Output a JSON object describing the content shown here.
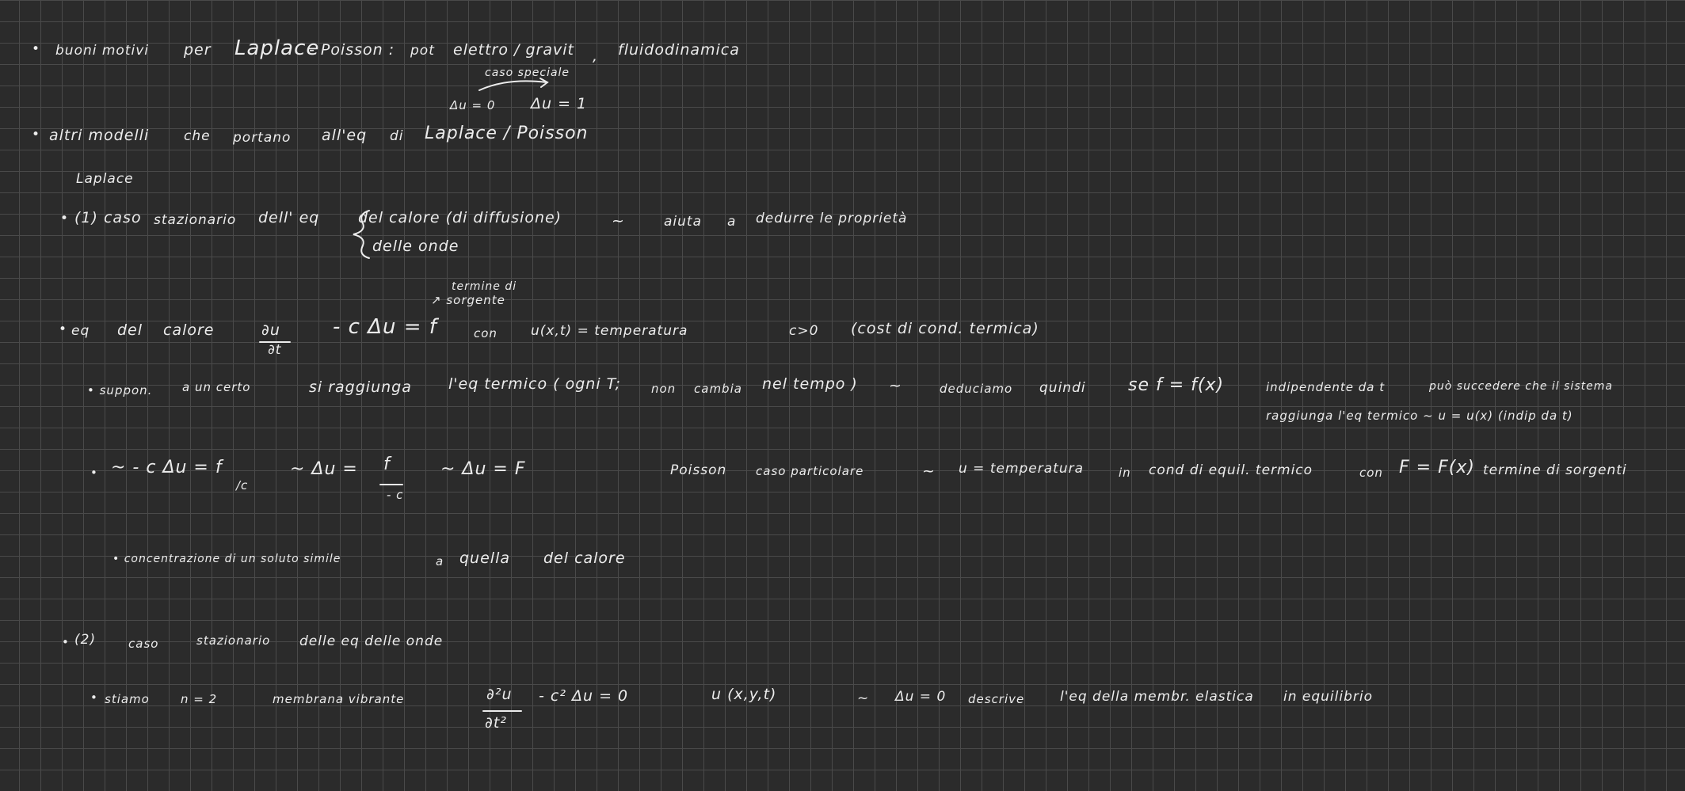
{
  "notes": {
    "line1": {
      "bullet": "•",
      "a": "buoni motivi",
      "b": "per",
      "c": "Laplace",
      "d": "- Poisson :",
      "e": "pot",
      "f": "elettro / gravit",
      "g": ",",
      "h": "fluidodinamica"
    },
    "annot1": {
      "caso": "caso speciale",
      "du0": "Δu = 0",
      "du1": "Δu = 1"
    },
    "line2": {
      "bullet": "•",
      "a": "altri modelli",
      "b": "che",
      "c": "portano",
      "d": "all'eq",
      "e": "di",
      "f": "Laplace / Poisson"
    },
    "laplace_label": "Laplace",
    "line3": {
      "bullet": "•",
      "a": "(1) caso",
      "b": "stazionario",
      "c": "dell' eq",
      "brace1": "del calore (di diffusione)",
      "brace2": "delle onde",
      "arrow": "~",
      "d": "aiuta",
      "e": "a",
      "f": "dedurre le proprietà"
    },
    "annot2": {
      "l1": "termine di",
      "l2": "↗ sorgente"
    },
    "line4": {
      "bullet": "•",
      "a": "eq",
      "b": "del",
      "c": "calore",
      "frac_num": "∂u",
      "frac_den": "∂t",
      "d": "- c Δu = f",
      "e": "con",
      "f": "u(x,t) = temperatura",
      "g": "c>0",
      "h": "(cost di cond. termica)"
    },
    "line5": {
      "a": "• suppon.",
      "b": "a un certo",
      "c": "si raggiunga",
      "d": "l'eq termico ( ogni T;",
      "e": "non",
      "f": "cambia",
      "g": "nel tempo )",
      "h": "~",
      "i": "deduciamo",
      "j": "quindi",
      "k": "se f = f(x)",
      "l": "indipendente da t",
      "m": "può succedere che il sistema",
      "n": "raggiunga l'eq termico ~ u = u(x) (indip da t)"
    },
    "line6": {
      "bullet": "•",
      "a": "~  - c Δu = f",
      "a_sub": "/c",
      "b": "~  Δu =",
      "b_num": "f",
      "b_den": "- c",
      "c": "~  Δu = F",
      "d": "Poisson",
      "e": "caso particolare",
      "f": "~",
      "g": "u = temperatura",
      "h": "in",
      "i": "cond di equil. termico",
      "j": "con",
      "k": "F = F(x)",
      "l": "termine di sorgenti"
    },
    "line7": {
      "a": "• concentrazione di un soluto simile",
      "b": "a",
      "c": "quella",
      "d": "del calore"
    },
    "line8": {
      "bullet": "•",
      "a": "(2)",
      "b": "caso",
      "c": "stazionario",
      "d": "delle eq delle onde"
    },
    "line9": {
      "bullet": "•",
      "a": "stiamo",
      "b": "n = 2",
      "c": "membrana vibrante",
      "frac_num": "∂²u",
      "frac_den": "∂t²",
      "d": "- c² Δu = 0",
      "e": "u (x,y,t)",
      "f": "~",
      "g": "Δu = 0",
      "h": "descrive",
      "i": "l'eq della membr. elastica",
      "j": "in equilibrio"
    }
  }
}
